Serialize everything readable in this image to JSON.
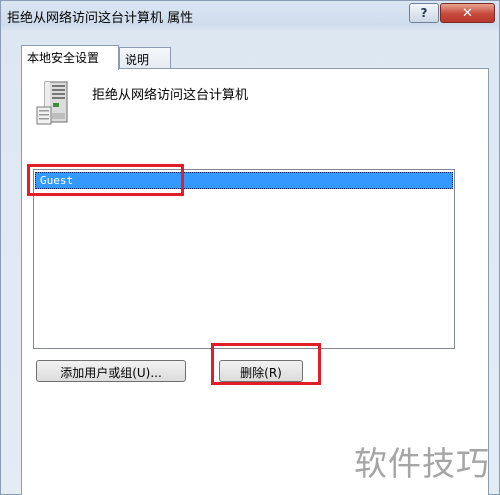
{
  "window": {
    "title": "拒绝从网络访问这台计算机 属性",
    "help_label": "?",
    "close_label": "✕"
  },
  "tabs": [
    {
      "label": "本地安全设置",
      "active": true
    },
    {
      "label": "说明",
      "active": false
    }
  ],
  "policy": {
    "icon": "server-icon",
    "name": "拒绝从网络访问这台计算机"
  },
  "list": {
    "items": [
      {
        "label": "Guest",
        "selected": true
      }
    ]
  },
  "buttons": {
    "add_label": "添加用户或组(U)...",
    "remove_label": "删除(R)"
  },
  "colors": {
    "highlight": "#e11d2a",
    "selection": "#3399ff"
  },
  "watermark": "软件技巧"
}
